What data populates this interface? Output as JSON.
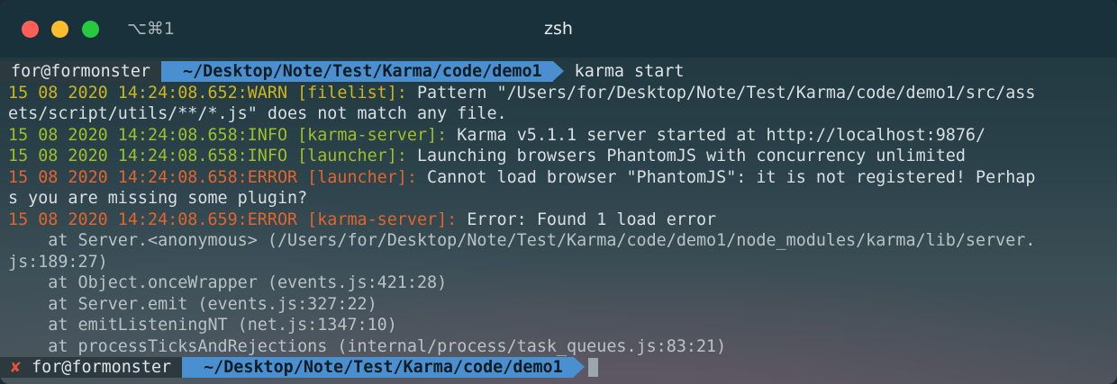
{
  "window": {
    "shortcut": "⌥⌘1",
    "title": "zsh"
  },
  "prompt1": {
    "user": "for@formonster",
    "path": "~/Desktop/Note/Test/Karma/code/demo1",
    "command": "karma start"
  },
  "log": {
    "l1_prefix": "15 08 2020 14:24:08.652:WARN [filelist]:",
    "l1_msg": " Pattern \"/Users/for/Desktop/Note/Test/Karma/code/demo1/src/ass",
    "l1_cont": "ets/script/utils/**/*.js\" does not match any file.",
    "l2_prefix": "15 08 2020 14:24:08.658:INFO [karma-server]:",
    "l2_msg": " Karma v5.1.1 server started at http://localhost:9876/",
    "l3_prefix": "15 08 2020 14:24:08.658:INFO [launcher]:",
    "l3_msg": " Launching browsers PhantomJS with concurrency unlimited",
    "l4_prefix": "15 08 2020 14:24:08.658:ERROR [launcher]:",
    "l4_msg": " Cannot load browser \"PhantomJS\": it is not registered! Perhap",
    "l4_cont": "s you are missing some plugin?",
    "l5_prefix": "15 08 2020 14:24:08.659:ERROR [karma-server]:",
    "l5_msg": " Error: Found 1 load error",
    "t1": "    at Server.<anonymous> (/Users/for/Desktop/Note/Test/Karma/code/demo1/node_modules/karma/lib/server.",
    "t1_cont": "js:189:27)",
    "t2": "    at Object.onceWrapper (events.js:421:28)",
    "t3": "    at Server.emit (events.js:327:22)",
    "t4": "    at emitListeningNT (net.js:1347:10)",
    "t5": "    at processTicksAndRejections (internal/process/task_queues.js:83:21)"
  },
  "prompt2": {
    "status_mark": "✘",
    "user": "for@formonster",
    "path": "~/Desktop/Note/Test/Karma/code/demo1"
  },
  "colors": {
    "warn": "#cdb51f",
    "info": "#9fbf2a",
    "error": "#e0652e",
    "path_segment": "#4a90d0"
  }
}
